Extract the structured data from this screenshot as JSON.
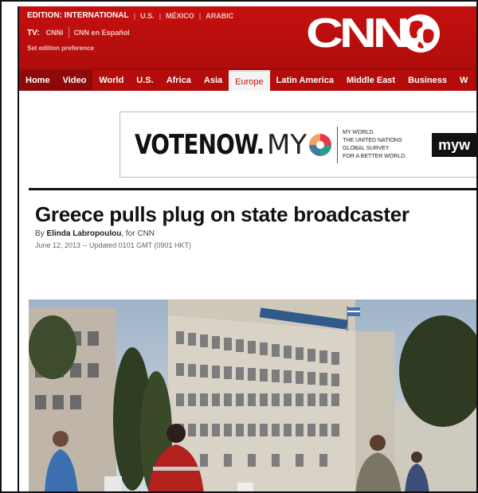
{
  "header": {
    "edition_label": "EDITION: INTERNATIONAL",
    "editions": [
      "U.S.",
      "MÉXICO",
      "ARABIC"
    ],
    "tv_label": "TV:",
    "tv_links": [
      "CNNi",
      "CNN en Español"
    ],
    "preference_link": "Set edition preference",
    "logo_text": "CNN"
  },
  "nav": {
    "items": [
      "Home",
      "Video",
      "World",
      "U.S.",
      "Africa",
      "Asia",
      "Europe",
      "Latin America",
      "Middle East",
      "Business",
      "W"
    ],
    "active": "Europe"
  },
  "ad": {
    "vote_text": "VOTENOW.",
    "my_text": "MY",
    "tagline": [
      "MY WORLD.",
      "THE UNITED NATIONS",
      "GLOBAL SURVEY",
      "FOR A BETTER WORLD."
    ],
    "button_text": "myw"
  },
  "article": {
    "headline": "Greece pulls plug on state broadcaster",
    "byline_prefix": "By ",
    "author": "Elinda Labropoulou",
    "byline_suffix": ", for CNN",
    "dateline": "June 12, 2013 -- Updated 0101 GMT (0901 HKT)"
  },
  "colors": {
    "brand_red": "#c4100f",
    "nav_dark": "#8e0a09"
  }
}
